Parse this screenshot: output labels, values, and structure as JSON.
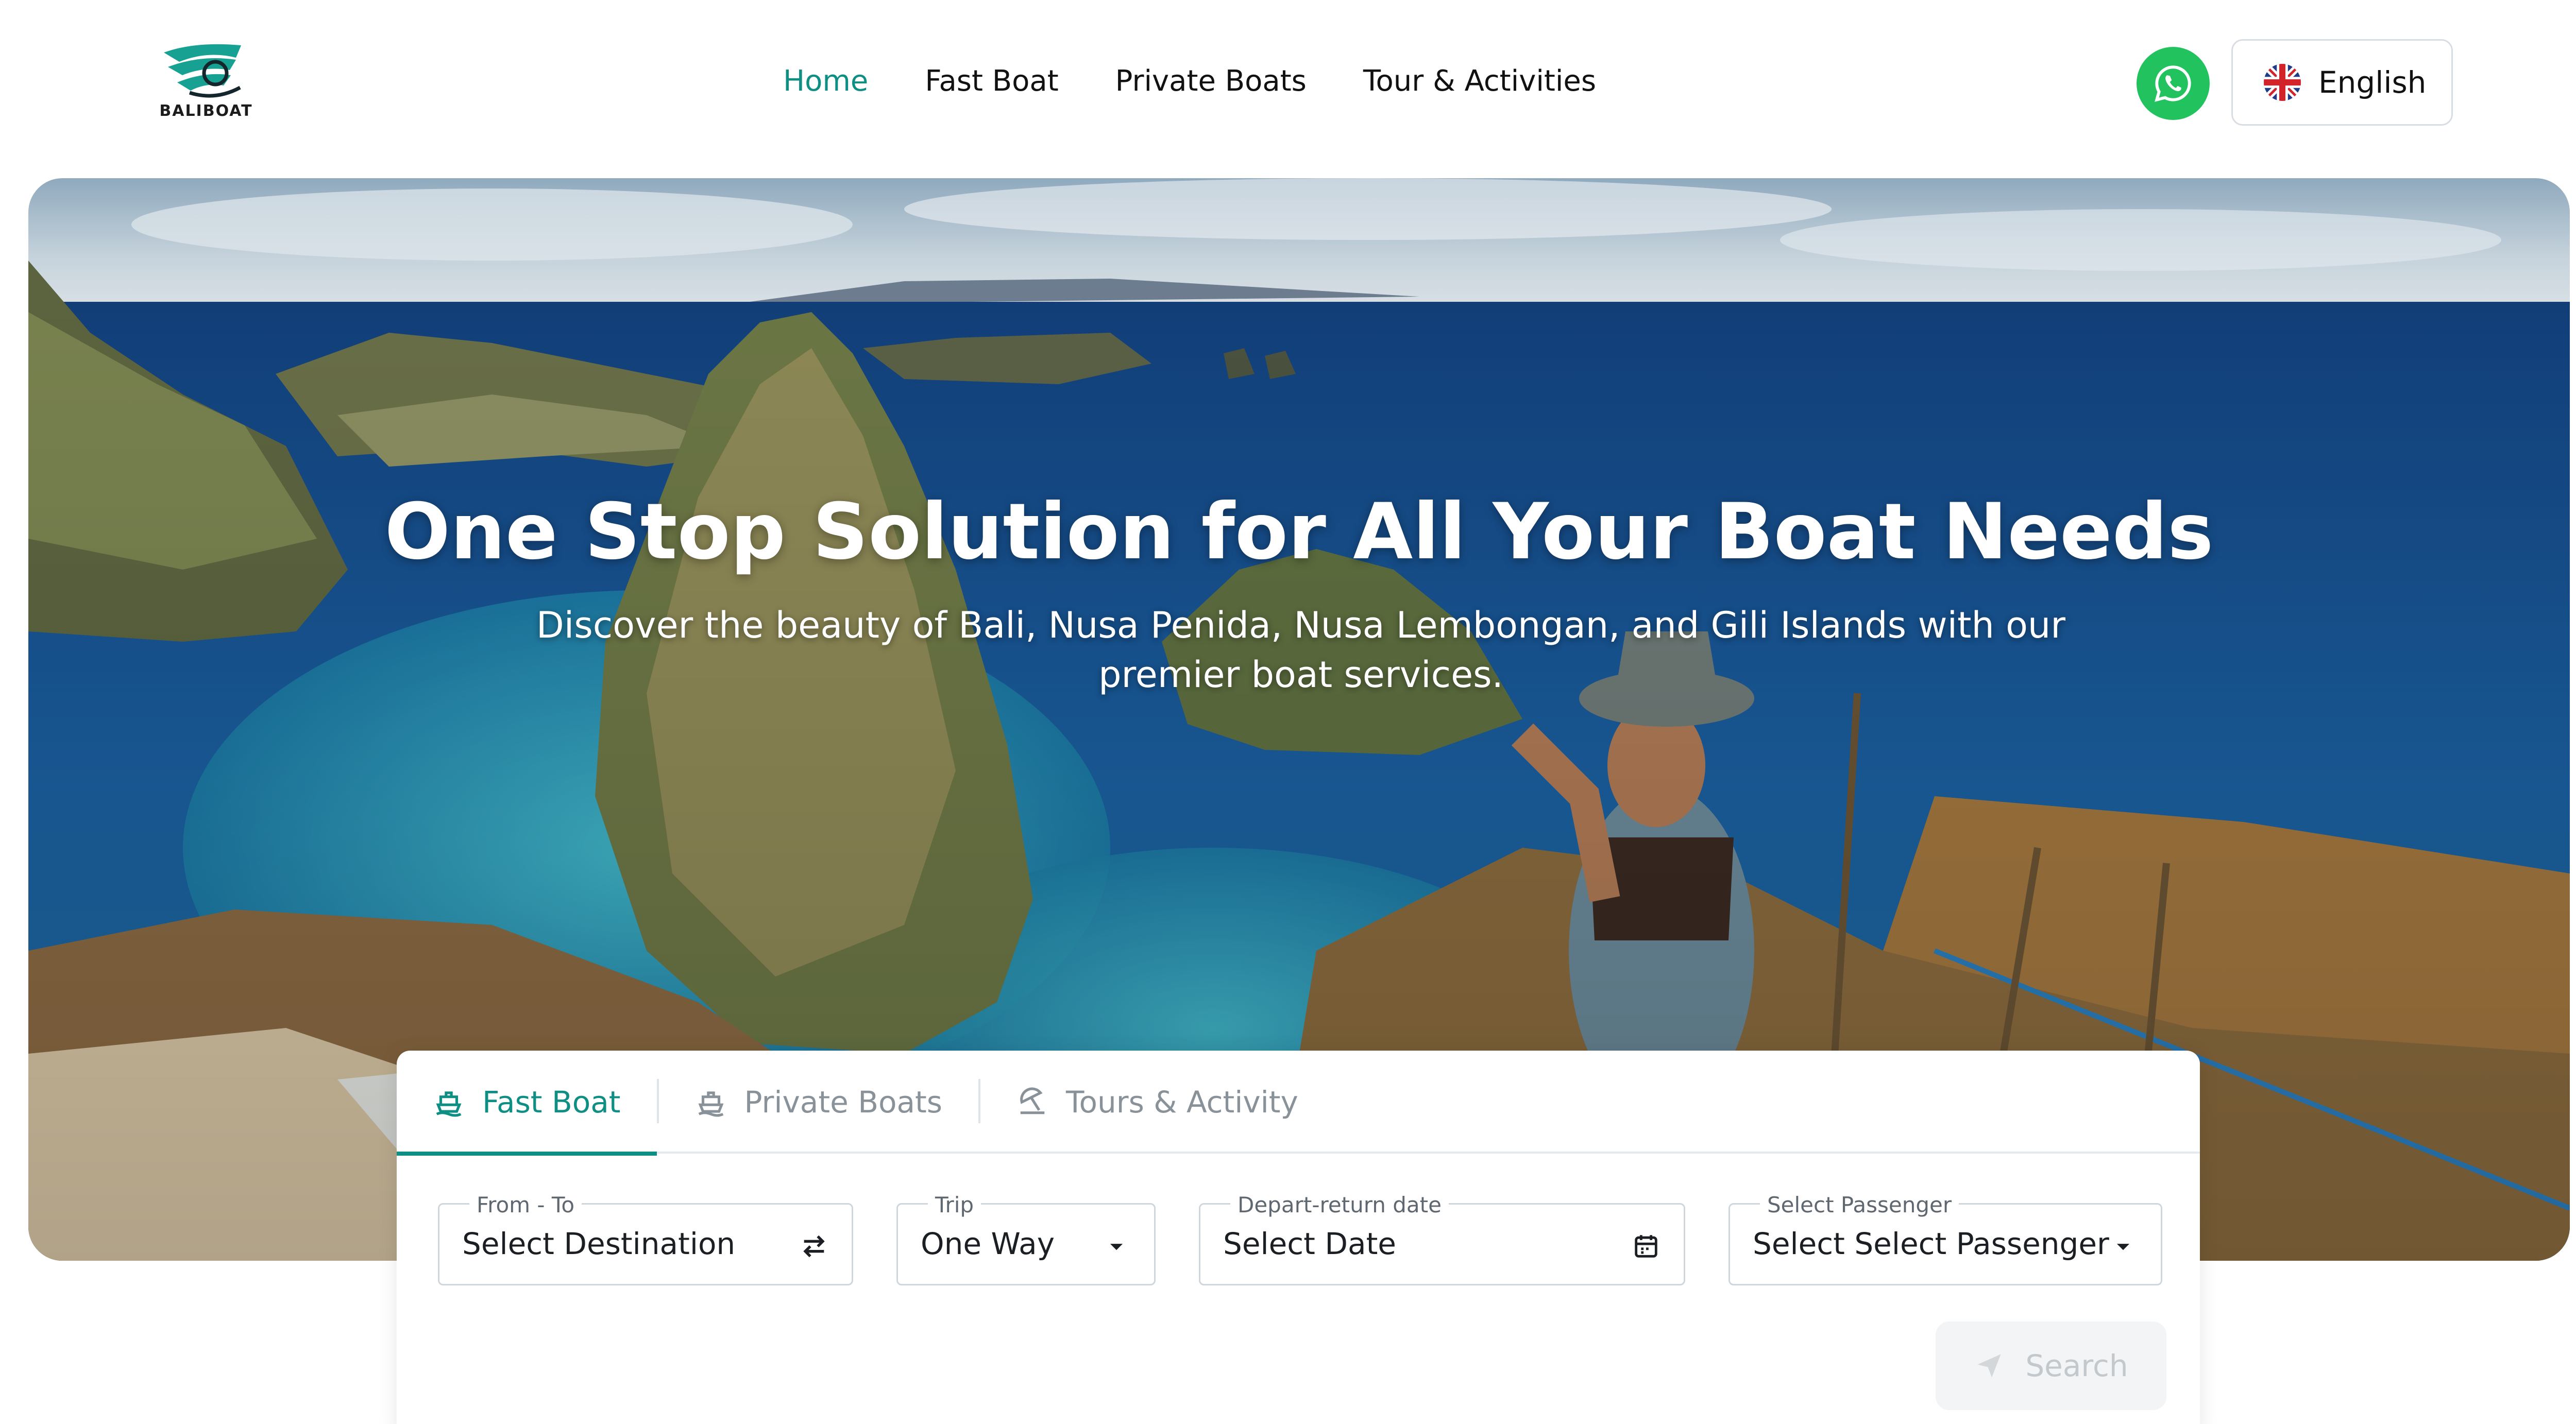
{
  "brand": {
    "logo_text": "BALIBOAT",
    "accent_color": "#0f8f83"
  },
  "nav": {
    "items": [
      {
        "label": "Home",
        "active": true
      },
      {
        "label": "Fast Boat",
        "active": false
      },
      {
        "label": "Private Boats",
        "active": false
      },
      {
        "label": "Tour & Activities",
        "active": false
      }
    ]
  },
  "header": {
    "whatsapp_icon": "whatsapp-icon",
    "whatsapp_color": "#22c35e",
    "language": {
      "label": "English",
      "flag_icon": "uk-flag-icon"
    }
  },
  "hero": {
    "title": "One Stop Solution for All Your Boat Needs",
    "subtitle": "Discover the beauty of Bali, Nusa Penida, Nusa Lembongan, and Gili Islands with our premier boat services."
  },
  "booking": {
    "tabs": [
      {
        "label": "Fast Boat",
        "icon": "ferry-icon",
        "active": true
      },
      {
        "label": "Private Boats",
        "icon": "ship-icon",
        "active": false
      },
      {
        "label": "Tours & Activity",
        "icon": "beach-umbrella-icon",
        "active": false
      }
    ],
    "fields": {
      "route": {
        "label": "From - To",
        "value": "Select Destination",
        "icon": "swap-icon"
      },
      "trip": {
        "label": "Trip",
        "value": "One Way",
        "icon": "caret-down-icon"
      },
      "date": {
        "label": "Depart-return date",
        "value": "Select Date",
        "icon": "calendar-icon"
      },
      "passenger": {
        "label": "Select Passenger",
        "value": "Select Select Passenger",
        "icon": "caret-down-icon"
      }
    },
    "search_label": "Search",
    "search_icon": "send-icon"
  }
}
